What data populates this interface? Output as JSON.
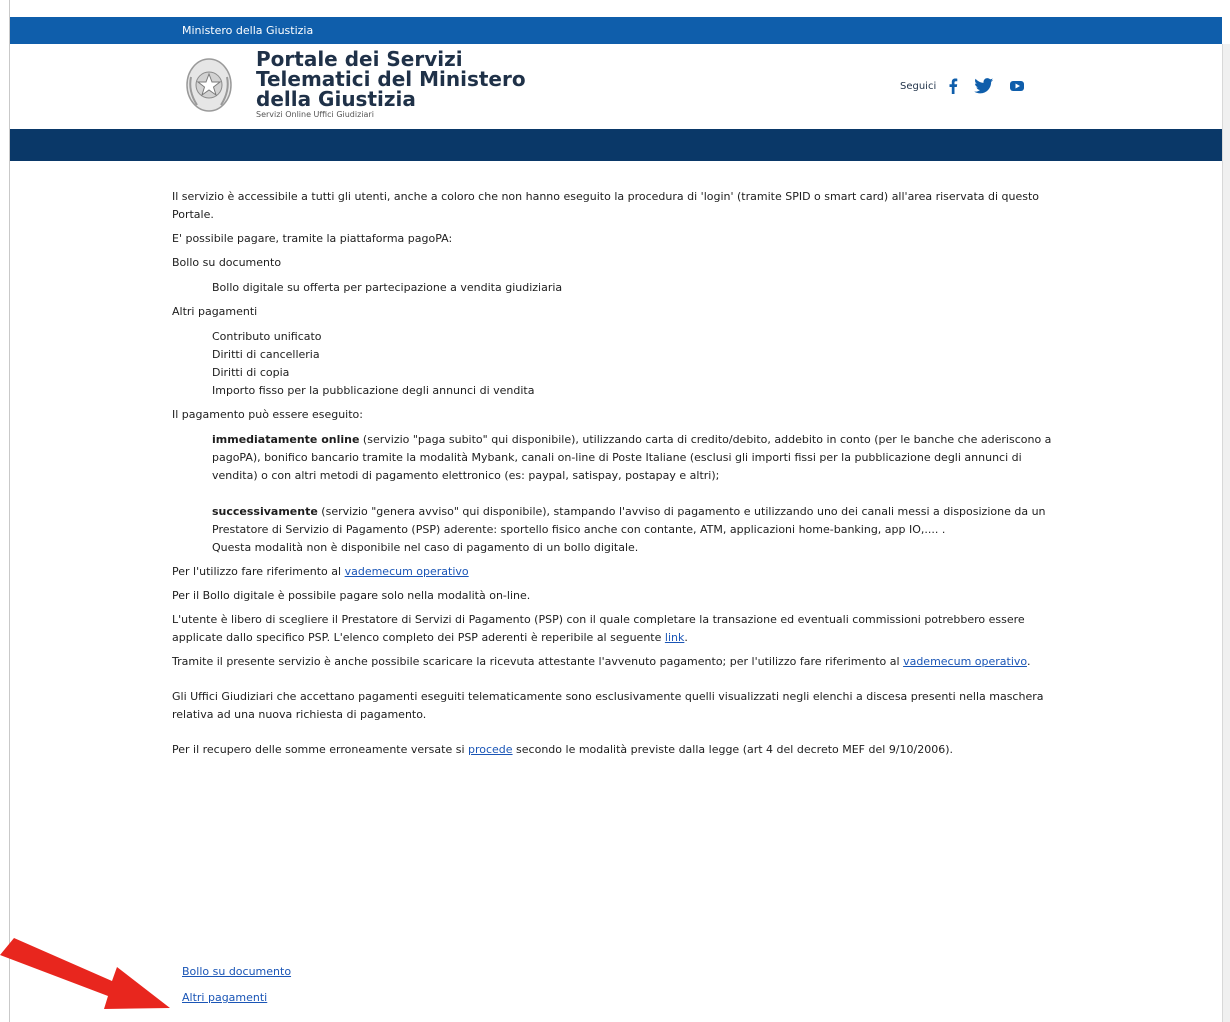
{
  "topbar": {
    "ministry": "Ministero della Giustizia"
  },
  "header": {
    "title_line1": "Portale dei Servizi",
    "title_line2": "Telematici del Ministero",
    "title_line3": "della Giustizia",
    "subtitle": "Servizi Online Uffici Giudiziari",
    "follow_label": "Seguici",
    "social_icons": [
      "facebook-icon",
      "twitter-icon",
      "youtube-icon"
    ]
  },
  "content": {
    "intro": "Il servizio è accessibile a tutti gli utenti, anche a coloro che non hanno eseguito la procedura di 'login' (tramite SPID o smart card) all'area riservata di questo Portale.",
    "possible": "E' possibile pagare, tramite la piattaforma pagoPA:",
    "bollo_heading": "Bollo su documento",
    "bollo_item": "Bollo digitale su offerta per partecipazione a vendita giudiziaria",
    "altri_heading": "Altri pagamenti",
    "altri_items": [
      "Contributo unificato",
      "Diritti di cancelleria",
      "Diritti di copia",
      "Importo fisso per la pubblicazione degli annunci di vendita"
    ],
    "payment_modes": "Il pagamento può essere eseguito:",
    "immediate_bold": "immediatamente online",
    "immediate_text": " (servizio \"paga subito\" qui disponibile), utilizzando carta di credito/debito, addebito in conto (per le banche che aderiscono a pagoPA), bonifico bancario tramite la modalità Mybank, canali on-line di Poste Italiane (esclusi gli importi fissi per la pubblicazione degli annunci di vendita) o con altri metodi di pagamento elettronico (es: paypal, satispay, postapay e altri);",
    "later_bold": "successivamente",
    "later_text": " (servizio \"genera avviso\" qui disponibile), stampando l'avviso di pagamento e utilizzando uno dei canali messi a disposizione da un Prestatore di Servizio di Pagamento (PSP) aderente: sportello fisico anche con contante, ATM, applicazioni home-banking, app IO,.... .",
    "later_note": "Questa modalità non è disponibile nel caso di pagamento di un bollo digitale.",
    "usage_prefix": "Per l'utilizzo fare riferimento al ",
    "vademecum_link": "vademecum operativo",
    "bollo_online": "Per il Bollo digitale è possibile pagare solo nella modalità on-line.",
    "psp_text": "L'utente è libero di scegliere il Prestatore di Servizi di Pagamento (PSP) con il quale completare la transazione ed eventuali commissioni potrebbero essere applicate dallo specifico PSP. L'elenco completo dei PSP aderenti è reperibile al seguente ",
    "psp_link": "link",
    "psp_end": ".",
    "receipt_text": "Tramite il presente servizio è anche possibile scaricare la ricevuta attestante l'avvenuto pagamento; per l'utilizzo fare riferimento al ",
    "receipt_link": "vademecum operativo",
    "receipt_end": ".",
    "offices_text": "Gli Uffici Giudiziari che accettano pagamenti eseguiti telematicamente sono esclusivamente quelli visualizzati negli elenchi a discesa presenti nella maschera relativa ad una nuova richiesta di pagamento.",
    "refund_prefix": "Per il recupero delle somme erroneamente versate si ",
    "refund_link": "procede",
    "refund_suffix": " secondo le modalità previste dalla legge (art 4 del decreto MEF del 9/10/2006)."
  },
  "bottom_links": {
    "bollo": "Bollo su documento",
    "altri": "Altri pagamenti"
  },
  "colors": {
    "topbar": "#0f5eab",
    "navbar": "#0a3868",
    "link": "#1a55b6",
    "arrow": "#e8261e"
  }
}
